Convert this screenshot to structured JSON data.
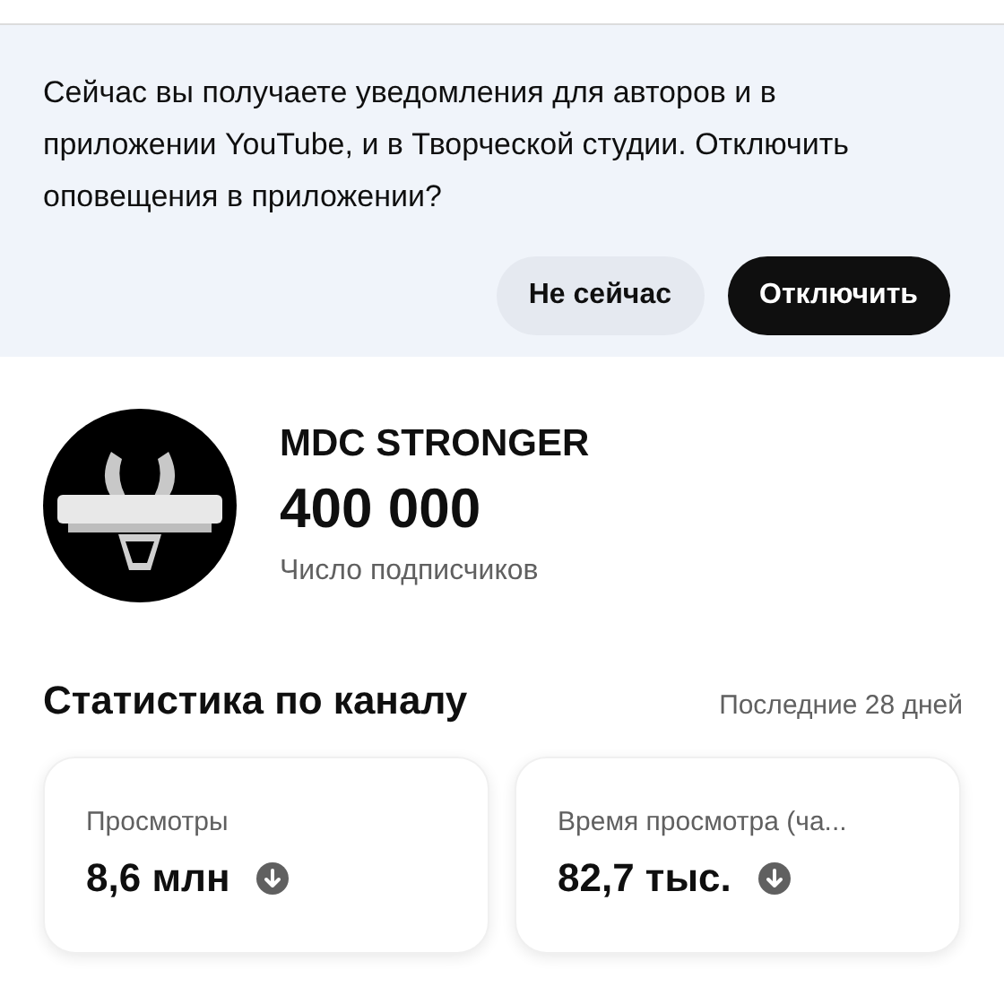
{
  "notice": {
    "message": "Сейчас вы получаете уведомления для авторов и в приложении YouTube, и в Творческой студии. Отключить оповещения в приложении?",
    "buttons": [
      {
        "label": "Не сейчас",
        "kind": "secondary"
      },
      {
        "label": "Отключить",
        "kind": "primary"
      }
    ]
  },
  "channel": {
    "name": "MDC STRONGER",
    "subscribers": "400 000",
    "subscribers_label": "Число подписчиков"
  },
  "stats": {
    "title": "Статистика по каналу",
    "period": "Последние 28 дней",
    "cards": [
      {
        "label": "Просмотры",
        "value": "8,6 млн",
        "decreased": true
      },
      {
        "label": "Время просмотра (ча...",
        "value": "82,7 тыс.",
        "decreased": true
      }
    ]
  }
}
